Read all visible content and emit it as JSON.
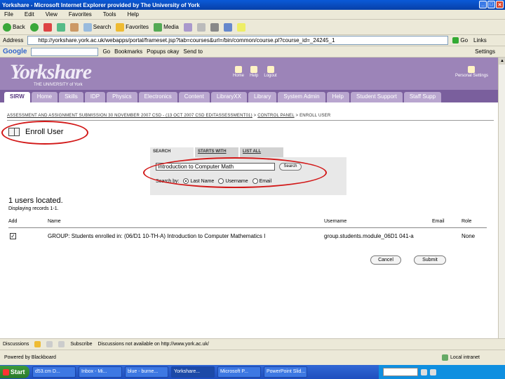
{
  "window": {
    "title": "Yorkshare - Microsoft Internet Explorer provided by The University of York"
  },
  "menu": [
    "File",
    "Edit",
    "View",
    "Favorites",
    "Tools",
    "Help"
  ],
  "toolbar": {
    "back": "Back",
    "search": "Search",
    "favorites": "Favorites",
    "media": "Media"
  },
  "address": {
    "label": "Address",
    "url": "http://yorkshare.york.ac.uk/webapps/portal/frameset.jsp?tab=courses&url=/bin/common/course.pl?course_id=_24245_1",
    "go": "Go",
    "links": "Links"
  },
  "googlebar": {
    "logo": "Google",
    "go": "Go",
    "bookmarks": "Bookmarks",
    "popups": "Popups okay",
    "send": "Send to",
    "settings": "Settings"
  },
  "banner": {
    "logo": "Yorkshare",
    "logo_sub": "THE UNIVERSITY of York",
    "nav": [
      "Home",
      "Help",
      "Logout"
    ],
    "personal": "Personal Settings"
  },
  "tabs": [
    "SIRW",
    "Home",
    "Skills",
    "IDP",
    "Physics",
    "Electronics",
    "Content",
    "LibraryXX",
    "Library",
    "System Admin",
    "Help",
    "Student Support",
    "Staff Supp"
  ],
  "breadcrumb": {
    "course": "ASSESSMENT AND ASSIGNMENT SUBMISSION 30 NOVEMBER 2007 CSD - (13 OCT 2007 CSD EDITASSESSMENT01)",
    "panel": "CONTROL PANEL",
    "current": "ENROLL USER"
  },
  "page_title": "Enroll User",
  "search": {
    "tabs": [
      "SEARCH",
      "STARTS WITH",
      "LIST ALL"
    ],
    "value": "Introduction to Computer Math",
    "button": "Search",
    "by_label": "Search by:",
    "options": [
      "Last Name",
      "Username",
      "Email"
    ]
  },
  "results": {
    "count_text": "1 users located.",
    "displaying": "Displaying records 1-1.",
    "columns": [
      "Add",
      "Name",
      "Username",
      "Email",
      "Role"
    ],
    "rows": [
      {
        "name": "GROUP: Students enrolled in: (06/D1 10-TH-A) Introduction to Computer Mathematics I",
        "username": "group.students.module_06D1 041-a",
        "email": "",
        "role": "None"
      }
    ]
  },
  "buttons": {
    "cancel": "Cancel",
    "submit": "Submit"
  },
  "linksbar": {
    "discussions": "Discussions",
    "subscribe": "Subscribe",
    "note": "Discussions not available on http://www.york.ac.uk/"
  },
  "statusbar": {
    "text": "Powered by Blackboard",
    "zone": "Local intranet"
  },
  "taskbar": {
    "start": "Start",
    "tasks": [
      "d53.cm D...",
      "Inbox - Mi...",
      "blue - burne...",
      "Yorkshare...",
      "Microsoft P...",
      "PowerPoint Slid..."
    ]
  }
}
